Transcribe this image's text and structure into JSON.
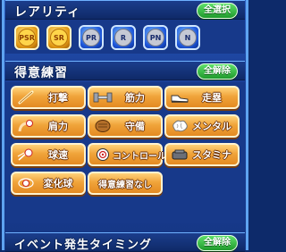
{
  "rarity": {
    "title": "レアリティ",
    "select_all": "全選択",
    "items": [
      {
        "label": "PSR",
        "tone": "gold",
        "icon": "psr-rarity-icon"
      },
      {
        "label": "SR",
        "tone": "gold",
        "icon": "sr-rarity-icon"
      },
      {
        "label": "PR",
        "tone": "blue",
        "icon": "pr-rarity-icon"
      },
      {
        "label": "R",
        "tone": "blue",
        "icon": "r-rarity-icon"
      },
      {
        "label": "PN",
        "tone": "blue",
        "icon": "pn-rarity-icon"
      },
      {
        "label": "N",
        "tone": "blue",
        "icon": "n-rarity-icon"
      }
    ]
  },
  "skills": {
    "title": "得意練習",
    "clear_all": "全解除",
    "items": [
      {
        "label": "打撃",
        "icon": "bat-icon",
        "glyph": "⚾"
      },
      {
        "label": "筋力",
        "icon": "dumbbell-icon",
        "glyph": "▣"
      },
      {
        "label": "走塁",
        "icon": "shoe-icon",
        "glyph": "➤"
      },
      {
        "label": "肩力",
        "icon": "throwing-arm-icon",
        "glyph": "●"
      },
      {
        "label": "守備",
        "icon": "glove-icon",
        "glyph": "✋"
      },
      {
        "label": "メンタル",
        "icon": "brain-icon",
        "glyph": "☁"
      },
      {
        "label": "球速",
        "icon": "speed-ball-icon",
        "glyph": "◔"
      },
      {
        "label": "コントロール",
        "icon": "target-icon",
        "glyph": "◎"
      },
      {
        "label": "スタミナ",
        "icon": "stamina-icon",
        "glyph": "▮"
      },
      {
        "label": "変化球",
        "icon": "breaking-ball-icon",
        "glyph": "◉"
      },
      {
        "label": "得意練習なし",
        "icon": "",
        "glyph": ""
      }
    ]
  },
  "event": {
    "title": "イベント発生タイミング",
    "clear_all": "全解除"
  }
}
